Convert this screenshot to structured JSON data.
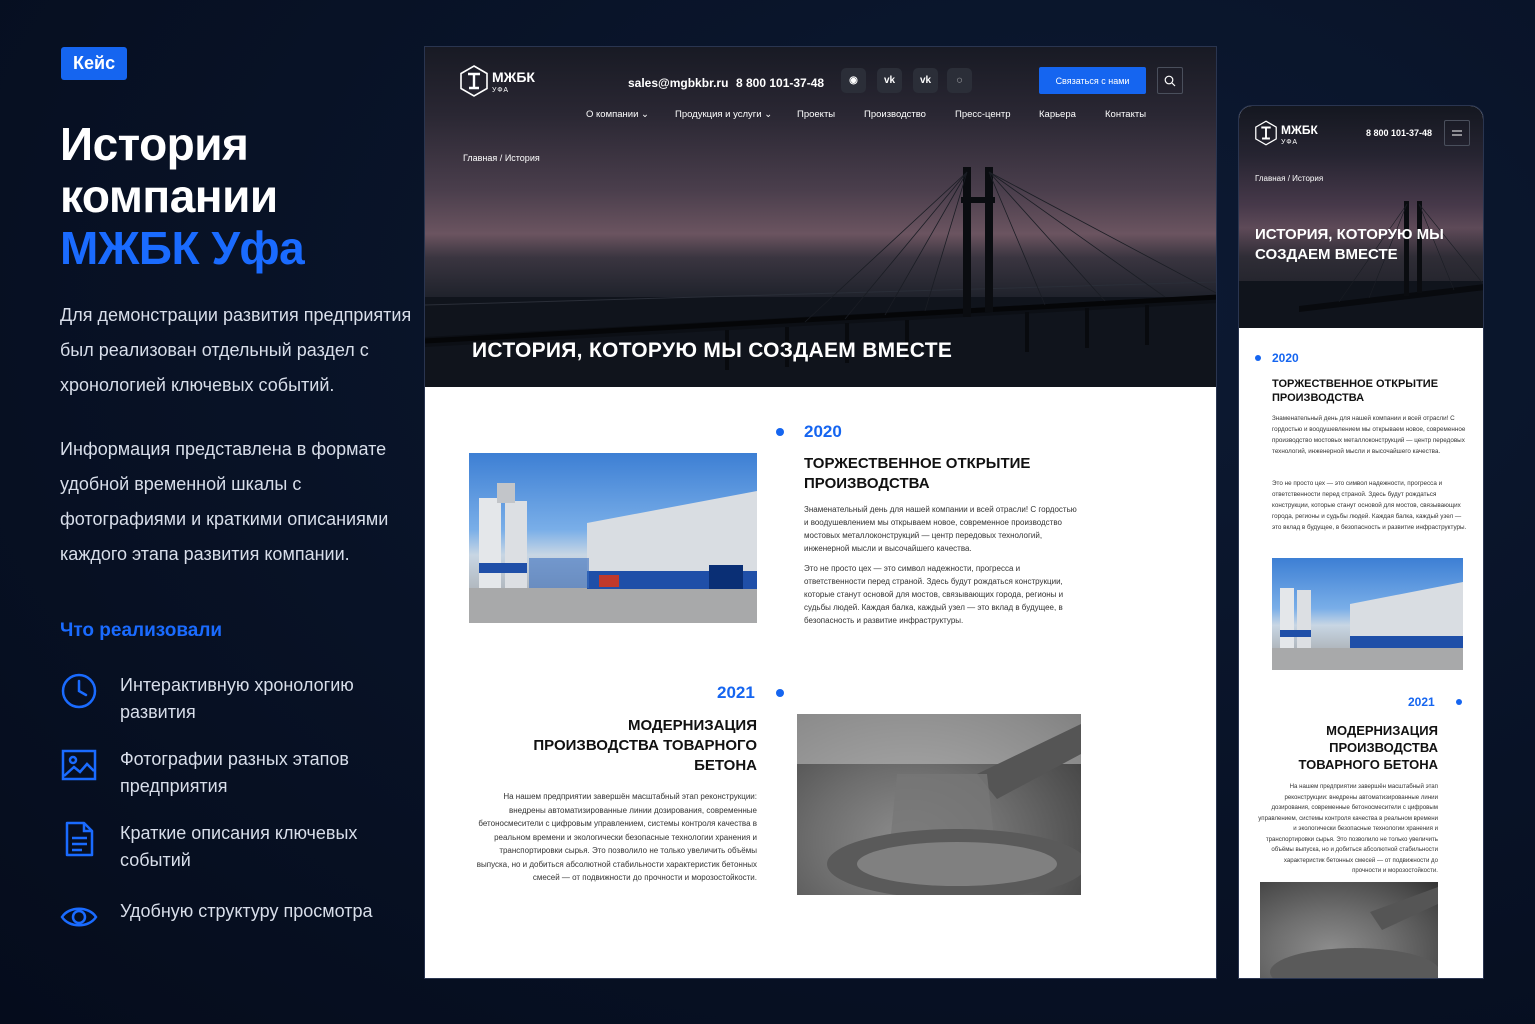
{
  "badge": "Кейс",
  "hero": {
    "line1": "История",
    "line2": "компании",
    "line3": "МЖБК Уфа"
  },
  "paragraphs": [
    "Для демонстрации развития предприятия был реализован отдельный раздел с хронологией ключевых событий.",
    "Информация представлена в формате удобной временной шкалы с фотографиями и краткими описаниями каждого этапа развития компании."
  ],
  "implemented_title": "Что реализовали",
  "features": [
    {
      "icon": "clock-icon",
      "text": "Интерактивную хронологию развития"
    },
    {
      "icon": "image-icon",
      "text": "Фотографии разных этапов предприятия"
    },
    {
      "icon": "document-icon",
      "text": "Краткие описания ключевых событий"
    },
    {
      "icon": "eye-icon",
      "text": "Удобную структуру просмотра"
    }
  ],
  "colors": {
    "accent": "#1565f0",
    "background": "#081226"
  },
  "site": {
    "logo_name": "МЖБК",
    "logo_sub": "УФА",
    "email": "sales@mgbkbr.ru",
    "phone": "8 800 101-37-48",
    "socials": [
      {
        "icon": "whatsapp-icon",
        "label": "◉"
      },
      {
        "icon": "vk-icon",
        "label": "vk"
      },
      {
        "icon": "vk-icon",
        "label": "vk"
      },
      {
        "icon": "max-icon",
        "label": "◌"
      }
    ],
    "contact_button": "Связаться с нами",
    "nav": [
      "О компании",
      "Продукция и услуги",
      "Проекты",
      "Производство",
      "Пресс-центр",
      "Карьера",
      "Контакты"
    ],
    "breadcrumbs": {
      "home": "Главная",
      "sep": "/",
      "current": "История"
    },
    "hero_title": "ИСТОРИЯ, КОТОРУЮ МЫ СОЗДАЕМ ВМЕСТЕ",
    "events": [
      {
        "year": "2020",
        "title": "Торжественное открытие производства",
        "p1": "Знаменательный день для нашей компании и всей отрасли! С гордостью и воодушевлением мы открываем новое, современное производство мостовых металлоконструкций — центр передовых технологий, инженерной мысли и высочайшего качества.",
        "p2": "Это не просто цех — это символ надежности, прогресса и ответственности перед страной. Здесь будут рождаться конструкции, которые станут основой для мостов, связывающих города, регионы и судьбы людей. Каждая балка, каждый узел — это вклад в будущее, в безопасность и развитие инфраструктуры."
      },
      {
        "year": "2021",
        "title": "Модернизация производства товарного бетона",
        "p1": "На нашем предприятии завершён масштабный этап реконструкции: внедрены автоматизированные линии дозирования, современные бетоносмесители с цифровым управлением, системы контроля качества в реальном времени и экологически безопасные технологии хранения и транспортировки сырья. Это позволило не только увеличить объёмы выпуска, но и добиться абсолютной стабильности характеристик бетонных смесей — от подвижности до прочности и морозостойкости."
      }
    ]
  }
}
